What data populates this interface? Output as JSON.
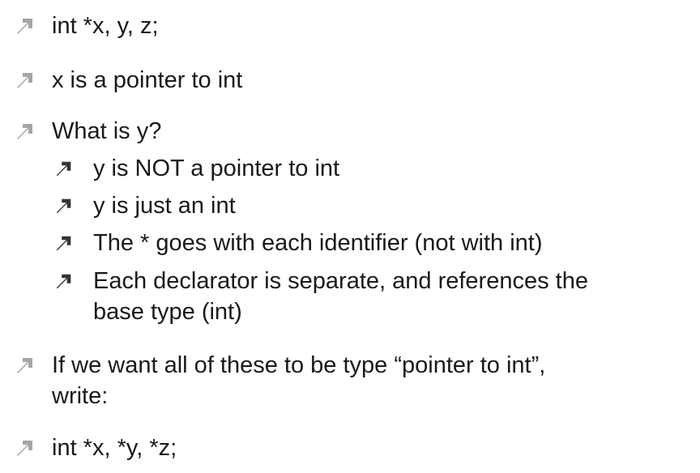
{
  "colors": {
    "level1_bullet": "#a6a6a6",
    "level2_bullet": "#333333",
    "text": "#1a1a1a"
  },
  "bullets": [
    {
      "level": 1,
      "text": "int *x, y, z;"
    },
    {
      "level": 1,
      "text": "x is a pointer to int"
    },
    {
      "level": 1,
      "text": "What is y?"
    },
    {
      "level": 2,
      "text": "y is NOT a pointer to int"
    },
    {
      "level": 2,
      "text": "y is just an int"
    },
    {
      "level": 2,
      "text": "The * goes with each identifier (not with int)"
    },
    {
      "level": 2,
      "text": "Each declarator is separate, and references the",
      "continuation": "base type (int)"
    },
    {
      "level": 1,
      "text": "If we want all of these to be type “pointer to int”,",
      "continuation": "write:"
    },
    {
      "level": 1,
      "text": "int *x, *y, *z;"
    }
  ]
}
